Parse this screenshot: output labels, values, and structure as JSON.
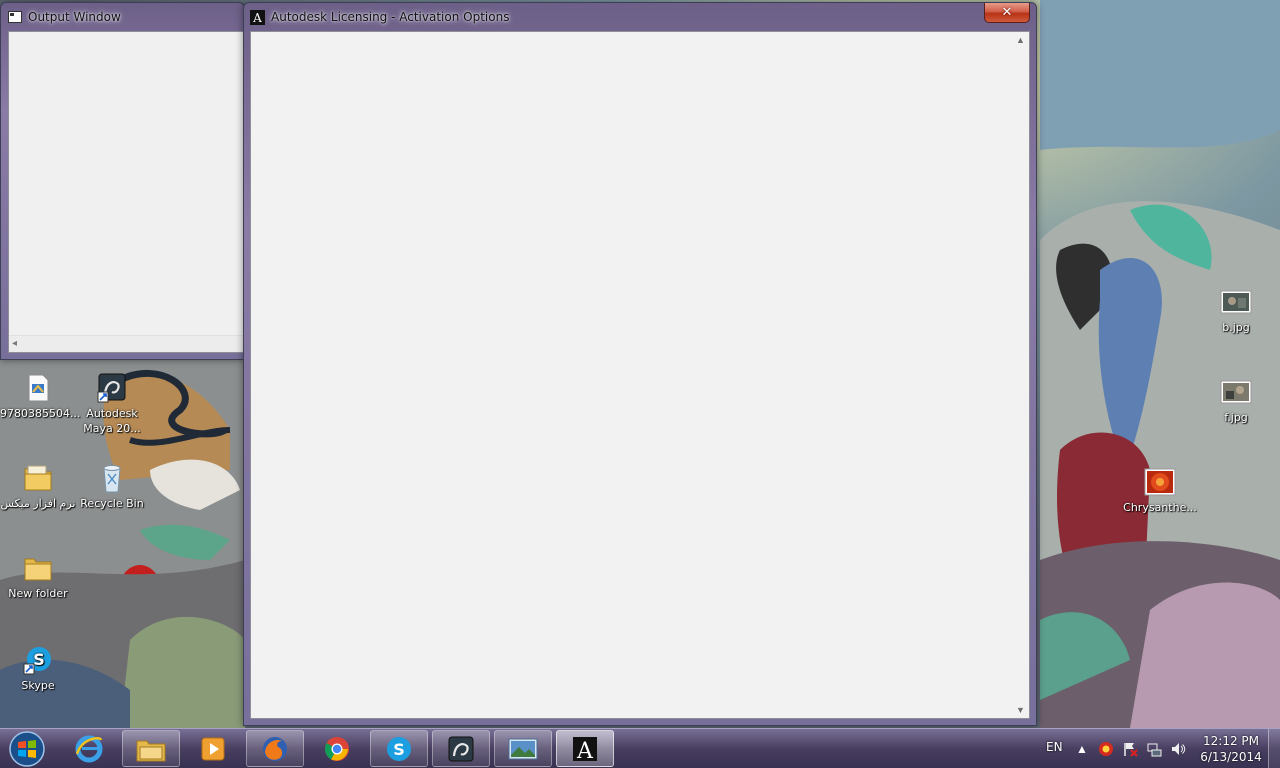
{
  "output_window": {
    "title": "Output Window"
  },
  "activation_window": {
    "title": "Autodesk Licensing - Activation Options",
    "close_glyph": "✕"
  },
  "desktop_icons_left": [
    {
      "name": "doc-file-icon",
      "label": "9780385504..."
    },
    {
      "name": "maya-shortcut-icon",
      "label": "Autodesk\nMaya 20..."
    },
    {
      "name": "folder-icon",
      "label": "نرم افزار میکس"
    },
    {
      "name": "recycle-bin-icon",
      "label": "Recycle Bin"
    },
    {
      "name": "folder-icon",
      "label": "New folder"
    },
    {
      "name": "skype-shortcut-icon",
      "label": "Skype"
    }
  ],
  "desktop_icons_right": [
    {
      "name": "image-file-icon",
      "label": "b.jpg"
    },
    {
      "name": "image-file-icon",
      "label": "f.jpg"
    },
    {
      "name": "image-file-icon",
      "label": "Chrysanthe..."
    }
  ],
  "taskbar": {
    "items": [
      {
        "name": "internet-explorer-icon",
        "state": "pinned"
      },
      {
        "name": "file-explorer-icon",
        "state": "open"
      },
      {
        "name": "media-player-icon",
        "state": "pinned"
      },
      {
        "name": "firefox-icon",
        "state": "open"
      },
      {
        "name": "chrome-icon",
        "state": "pinned"
      },
      {
        "name": "skype-icon",
        "state": "open"
      },
      {
        "name": "maya-icon",
        "state": "open"
      },
      {
        "name": "photo-viewer-icon",
        "state": "open"
      },
      {
        "name": "autodesk-icon",
        "state": "active"
      }
    ],
    "language": "EN",
    "clock_time": "12:12 PM",
    "clock_date": "6/13/2014"
  },
  "colors": {
    "close_button": "#c8462a",
    "window_frame": "#7a6d9a",
    "client_area": "#f2f2f2"
  }
}
